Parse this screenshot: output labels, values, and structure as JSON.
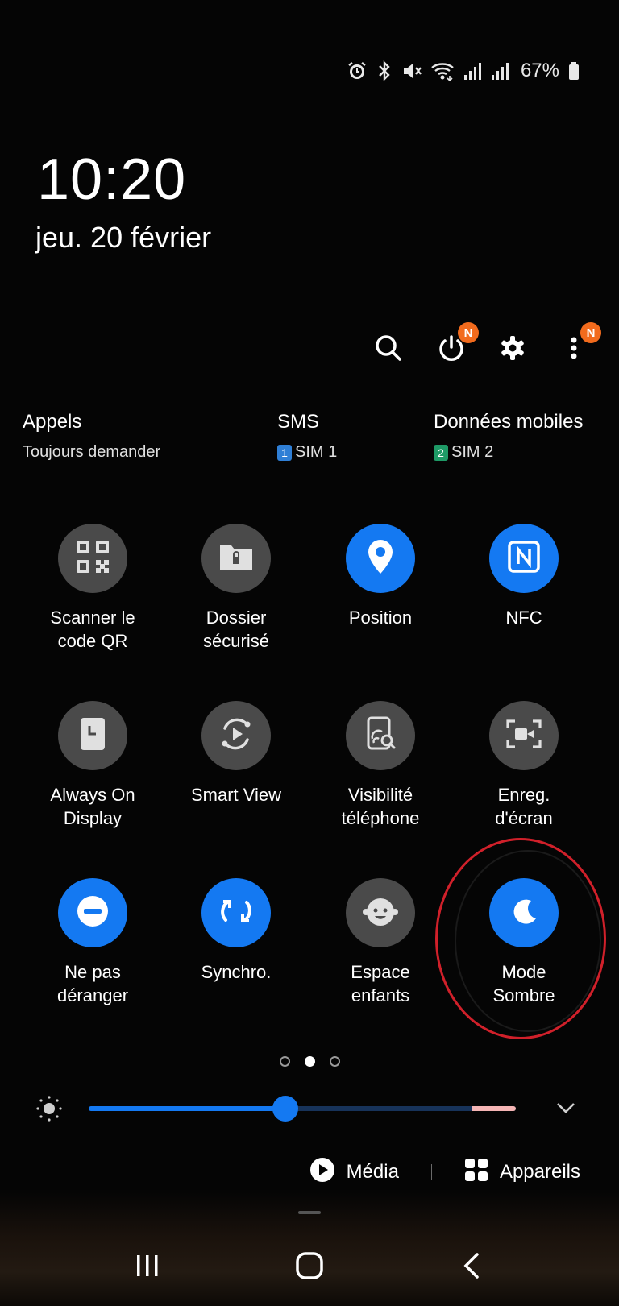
{
  "status_bar": {
    "battery_percent": "67%",
    "icons": [
      "alarm-icon",
      "bluetooth-icon",
      "mute-icon",
      "wifi-icon",
      "signal-sim1-icon",
      "signal-sim2-icon",
      "battery-icon"
    ]
  },
  "lockscreen": {
    "time": "10:20",
    "date": "jeu. 20 février"
  },
  "toolbar": {
    "icons": [
      "search-icon",
      "power-icon",
      "settings-icon",
      "more-icon"
    ],
    "power_badge": "N",
    "more_badge": "N"
  },
  "sim": {
    "calls": {
      "title": "Appels",
      "value": "Toujours demander"
    },
    "sms": {
      "title": "SMS",
      "sim_number": "1",
      "value": "SIM 1"
    },
    "data": {
      "title": "Données mobiles",
      "sim_number": "2",
      "value": "SIM 2"
    },
    "sim1_color": "#2f7fd6",
    "sim2_color": "#1e9a66"
  },
  "tiles": [
    {
      "label": "Scanner le\ncode QR",
      "icon": "qr-code-icon",
      "active": false
    },
    {
      "label": "Dossier\nsécurisé",
      "icon": "secure-folder-icon",
      "active": false
    },
    {
      "label": "Position",
      "icon": "location-icon",
      "active": true
    },
    {
      "label": "NFC",
      "icon": "nfc-icon",
      "active": true
    },
    {
      "label": "Always On\nDisplay",
      "icon": "always-on-display-icon",
      "active": false
    },
    {
      "label": "Smart View",
      "icon": "smart-view-icon",
      "active": false
    },
    {
      "label": "Visibilité\ntéléphone",
      "icon": "phone-visibility-icon",
      "active": false
    },
    {
      "label": "Enreg.\nd'écran",
      "icon": "screen-record-icon",
      "active": false
    },
    {
      "label": "Ne pas\ndéranger",
      "icon": "do-not-disturb-icon",
      "active": true
    },
    {
      "label": "Synchro.",
      "icon": "sync-icon",
      "active": true
    },
    {
      "label": "Espace\nenfants",
      "icon": "kids-icon",
      "active": false
    },
    {
      "label": "Mode\nSombre",
      "icon": "dark-mode-icon",
      "active": true
    }
  ],
  "pagination": {
    "total": 3,
    "current": 2
  },
  "brightness": {
    "level": 0.46
  },
  "media_bar": {
    "media_label": "Média",
    "devices_label": "Appareils"
  },
  "colors": {
    "accent": "#1479f2",
    "tile_off": "#4a4a4a",
    "highlight": "#d0202a",
    "badge": "#f26b1d"
  }
}
